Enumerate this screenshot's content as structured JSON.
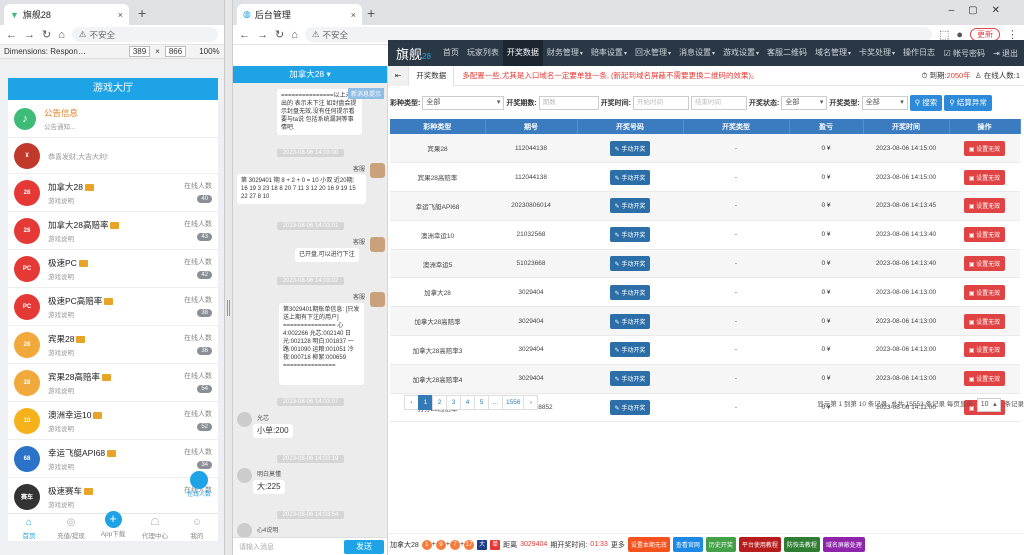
{
  "left_window": {
    "tab_title": "旗舰28",
    "new_tab": "+",
    "close": "×",
    "address": "不安全",
    "devtools": {
      "dimensions": "Dimensions: Respon…",
      "width": "389",
      "x": "×",
      "height": "866",
      "zoom": "100%"
    },
    "lobby_title": "游戏大厅",
    "notice": {
      "title": "公告信息",
      "sub": "公告通知..."
    },
    "banner_text": "恭喜发财,大吉大利!",
    "online_label": "在线人数",
    "games": [
      {
        "name": "加拿大28",
        "sub": "游戏说明",
        "count": "40",
        "color": "#e53935",
        "logo": "28"
      },
      {
        "name": "加拿大28高赔率",
        "sub": "游戏说明",
        "count": "43",
        "color": "#e53935",
        "logo": "28"
      },
      {
        "name": "极速PC",
        "sub": "游戏说明",
        "count": "42",
        "color": "#e53935",
        "logo": "PC"
      },
      {
        "name": "极速PC高赔率",
        "sub": "游戏说明",
        "count": "38",
        "color": "#e53935",
        "logo": "PC"
      },
      {
        "name": "宾果28",
        "sub": "游戏说明",
        "count": "36",
        "color": "#f2a93b",
        "logo": "28"
      },
      {
        "name": "宾果28高赔率",
        "sub": "游戏说明",
        "count": "54",
        "color": "#f2a93b",
        "logo": "28"
      },
      {
        "name": "澳洲幸运10",
        "sub": "游戏说明",
        "count": "52",
        "color": "#f6b21b",
        "logo": "10"
      },
      {
        "name": "幸运飞艇API68",
        "sub": "游戏说明",
        "count": "34",
        "color": "#2a73c8",
        "logo": "68"
      },
      {
        "name": "极速赛车",
        "sub": "游戏说明",
        "count": "",
        "color": "#333333",
        "logo": "赛车"
      }
    ],
    "float_online": "在线人数",
    "tabbar": [
      {
        "label": "首页",
        "icon": "⌂"
      },
      {
        "label": "充值/提现",
        "icon": "◎"
      },
      {
        "label": "App下载",
        "icon": "+"
      },
      {
        "label": "代理中心",
        "icon": "☖"
      },
      {
        "label": "我的",
        "icon": "☺"
      }
    ]
  },
  "right_window": {
    "tab_title": "后台管理",
    "new_tab": "+",
    "address": "不安全",
    "update_btn": "更新",
    "chat": {
      "header": "加拿大28",
      "new_msg": "新消息提示",
      "m1": "===============以上未列出的 表示未下注 如封盘会提示封盘无效,没有任何提示看要与ta说 包括系统漏洞等事情吧.",
      "t1": "2023-08-06 14:03:00",
      "m2_sender": "客服",
      "m2": "第 3029401 期 8 + 2 + 0 = 10 小双 近20期: 16 19 3 23 18 8 20 7 11 3 12 20 16 9 19 15 22 27 8 10",
      "t2": "2023-08-06 14:03:01",
      "m3_sender": "客服",
      "m3": "已开盘,可以进行下注",
      "t3": "2023-08-06 14:03:02",
      "m4_sender": "客服",
      "m4": "第3029401期账单信息: [只发送上期有下注的用户] =============== 心4:002266 允芯:002140 日光:002128 明白:001837 一路:001090 运粮:001051 冷夜:000718 柳絮:000659 ===============",
      "t4": "2023-08-06 14:03:07",
      "u1": "允芯",
      "u1_msg": "小单:200",
      "t5": "2023-08-06 14:03:19",
      "u2": "明白莫懂",
      "u2_msg": "大:225",
      "t6": "2023-08-06 14:03:54",
      "u3": "心4说明",
      "input_placeholder": "请输入消息",
      "send": "发送"
    },
    "admin": {
      "brand": "旗舰",
      "brand_num": "28",
      "nav": [
        "首页",
        "玩家列表",
        "开奖数据",
        "财务管理",
        "赔率设置",
        "回水管理",
        "消息设置",
        "游戏设置",
        "客服二维码",
        "域名管理",
        "卡奖处理",
        "操作日志"
      ],
      "nav_dropdown": [
        false,
        false,
        false,
        true,
        true,
        true,
        true,
        true,
        false,
        true,
        true,
        false
      ],
      "account": "帐号密码",
      "logout": "退出",
      "subtab": "开奖数据",
      "marquee": "多配置一些,尤其是入口域名一定要单独一条, (新起到域名屏蔽不需要更换二维码的效果)。",
      "expire_label": "到期:",
      "expire_val": "2050年",
      "online_label": "在线人数:",
      "online_val": "1",
      "filters": {
        "type_label": "彩种类型:",
        "type_val": "全部",
        "issue_label": "开奖期数:",
        "issue_ph": "期数",
        "time_label": "开奖时间:",
        "time_start": "开始时间",
        "time_end": "结束时间",
        "status_label": "开奖状态:",
        "status_val": "全部",
        "stat_type_label": "开奖类型:",
        "stat_type_val": "全部",
        "search": "搜索",
        "anomaly": "结算异常"
      },
      "columns": [
        "彩种类型",
        "期号",
        "开奖号码",
        "开奖类型",
        "盈亏",
        "开奖时间",
        "操作"
      ],
      "rows": [
        {
          "type": "宾果28",
          "issue": "112044138",
          "kind": "-",
          "profit": "0 ¥",
          "time": "2023-08-06 14:15:00"
        },
        {
          "type": "宾果28高赔率",
          "issue": "112044138",
          "kind": "-",
          "profit": "0 ¥",
          "time": "2023-08-06 14:15:00"
        },
        {
          "type": "幸运飞艇API68",
          "issue": "20230806014",
          "kind": "-",
          "profit": "0 ¥",
          "time": "2023-08-06 14:13:45"
        },
        {
          "type": "澳洲幸运10",
          "issue": "21032568",
          "kind": "-",
          "profit": "0 ¥",
          "time": "2023-08-06 14:13:40"
        },
        {
          "type": "澳洲幸运5",
          "issue": "51023668",
          "kind": "-",
          "profit": "0 ¥",
          "time": "2023-08-06 14:13:40"
        },
        {
          "type": "加拿大28",
          "issue": "3029404",
          "kind": "-",
          "profit": "0 ¥",
          "time": "2023-08-06 14:13:00"
        },
        {
          "type": "加拿大28高赔率",
          "issue": "3029404",
          "kind": "-",
          "profit": "0 ¥",
          "time": "2023-08-06 14:13:00"
        },
        {
          "type": "加拿大28高赔率3",
          "issue": "3029404",
          "kind": "-",
          "profit": "0 ¥",
          "time": "2023-08-06 14:13:00"
        },
        {
          "type": "加拿大28高赔率4",
          "issue": "3029404",
          "kind": "-",
          "profit": "0 ¥",
          "time": "2023-08-06 14:13:00"
        },
        {
          "type": "分分28高赔率",
          "issue": "202308068852",
          "kind": "-",
          "profit": "0 ¥",
          "time": "2023-08-06 14:11:00"
        }
      ],
      "open_btn": "手动开奖",
      "void_btn": "设置无效",
      "pages": [
        "‹",
        "1",
        "2",
        "3",
        "4",
        "5",
        "...",
        "1556",
        "›"
      ],
      "page_info": "显示第 1 到第 10 条记录, 总共 15553 条记录 每页显示",
      "page_size": "10",
      "page_suffix": "条记录",
      "bottom": {
        "game": "加拿大28",
        "balls": [
          "1",
          "9",
          "7",
          "17"
        ],
        "ball_colors": [
          "#f77b3a",
          "#f77b3a",
          "#f77b3a",
          "#f77b3a"
        ],
        "da": "大",
        "dan": "单",
        "dist_label": "距离",
        "issue": "3029404",
        "suffix": "期开奖时间:",
        "countdown": "01:33",
        "more": "更多",
        "buttons": [
          {
            "label": "设置本期无效",
            "color": "#f4511e"
          },
          {
            "label": "查看官网",
            "color": "#1e88e5"
          },
          {
            "label": "历史开奖",
            "color": "#43a047"
          },
          {
            "label": "平台使用教程",
            "color": "#b71c1c"
          },
          {
            "label": "防恢击教程",
            "color": "#2e7d32"
          },
          {
            "label": "域名屏蔽处理",
            "color": "#8e24aa"
          }
        ]
      }
    }
  }
}
